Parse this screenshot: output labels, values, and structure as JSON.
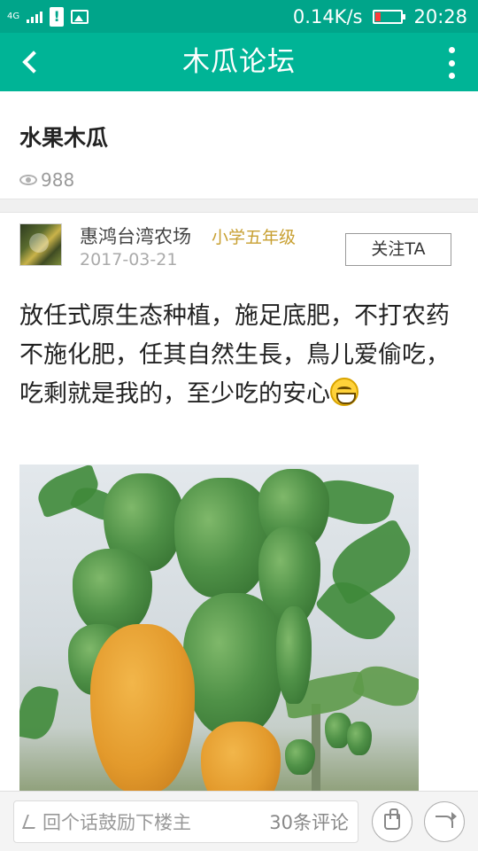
{
  "status_bar": {
    "network": "4G",
    "network2": "4G",
    "speed": "0.14K/s",
    "time": "20:28",
    "alert_glyph": "!",
    "icons": [
      "signal-icon",
      "alert-icon",
      "image-icon",
      "battery-icon"
    ],
    "battery_color": "#ff3b3b"
  },
  "header": {
    "title": "木瓜论坛",
    "back_icon": "back-arrow-icon",
    "more_icon": "more-vertical-icon",
    "color": "#00b496"
  },
  "post": {
    "title": "水果木瓜",
    "views": "988",
    "author": {
      "name": "惠鸿台湾农场",
      "level": "小学五年级",
      "date": "2017-03-21",
      "follow_label": "关注TA"
    },
    "body": "放任式原生态种植，施足底肥，不打农药不施化肥，任其自然生長，鳥儿爱偷吃，吃剩就是我的，至少吃的安心",
    "emoji": "grin-emoji-icon",
    "image": "papaya-photo"
  },
  "bottom_bar": {
    "comment_placeholder": "回个话鼓励下楼主",
    "comment_count": "30条评论",
    "like_icon": "thumbs-up-icon",
    "share_icon": "share-icon"
  }
}
